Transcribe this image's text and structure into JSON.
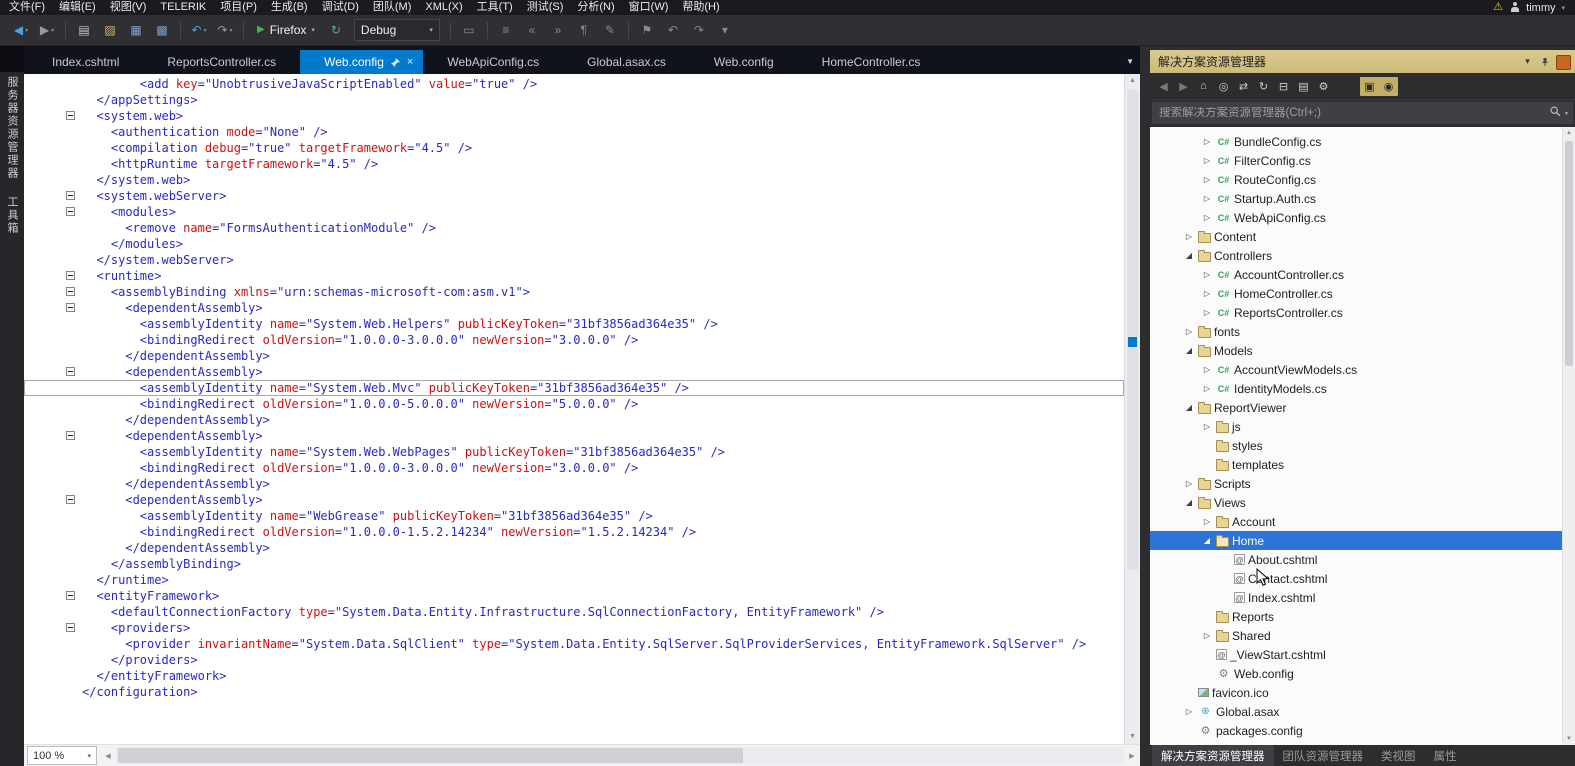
{
  "colors": {
    "accent": "#007acc",
    "selection": "#2e74d8",
    "xml_tag": "#2828c8",
    "xml_attr": "#d01010",
    "folder": "#e9d498",
    "folder_border": "#a98f4d",
    "csharp_green": "#36a163",
    "warning_yellow": "#f2c12e"
  },
  "menu": {
    "items": [
      "文件(F)",
      "编辑(E)",
      "视图(V)",
      "TELERIK",
      "项目(P)",
      "生成(B)",
      "调试(D)",
      "团队(M)",
      "XML(X)",
      "工具(T)",
      "测试(S)",
      "分析(N)",
      "窗口(W)",
      "帮助(H)"
    ],
    "warning_glyph": "⚠",
    "user": "timmy"
  },
  "toolbar": {
    "items": [
      {
        "type": "btn",
        "name": "navigate-back-button",
        "glyph": "◀",
        "color": "#4aa0e0",
        "caret": true
      },
      {
        "type": "btn",
        "name": "navigate-forward-button",
        "glyph": "▶",
        "color": "#9a9a9a",
        "caret": true
      },
      {
        "type": "sep"
      },
      {
        "type": "btn",
        "name": "new-file-button",
        "glyph": "▤",
        "color": "#c8c8c8"
      },
      {
        "type": "btn",
        "name": "open-file-button",
        "glyph": "▨",
        "color": "#d8b56a"
      },
      {
        "type": "btn",
        "name": "save-button",
        "glyph": "▦",
        "color": "#7f9fd0"
      },
      {
        "type": "btn",
        "name": "save-all-button",
        "glyph": "▩",
        "color": "#7f9fd0"
      },
      {
        "type": "sep"
      },
      {
        "type": "btn",
        "name": "undo-button",
        "glyph": "↶",
        "color": "#4aa0e0",
        "caret": true
      },
      {
        "type": "btn",
        "name": "redo-button",
        "glyph": "↷",
        "color": "#9a9a9a",
        "caret": true
      },
      {
        "type": "sep"
      },
      {
        "type": "run",
        "name": "start-debug-button",
        "label": "Firefox",
        "play_color": "#3db93d"
      },
      {
        "type": "btn",
        "name": "refresh-button",
        "glyph": "↻",
        "color": "#49b0a0"
      },
      {
        "type": "combo",
        "name": "solution-configuration-select",
        "label": "Debug"
      },
      {
        "type": "sep"
      },
      {
        "type": "btn",
        "name": "xml-schemas-button",
        "glyph": "▭",
        "color": "#8a8a8a"
      },
      {
        "type": "sep"
      },
      {
        "type": "btn",
        "name": "format-document-button",
        "glyph": "≡",
        "color": "#8a8a8a"
      },
      {
        "type": "btn",
        "name": "decrease-indent-button",
        "glyph": "«",
        "color": "#8a8a8a"
      },
      {
        "type": "btn",
        "name": "increase-indent-button",
        "glyph": "»",
        "color": "#8a8a8a"
      },
      {
        "type": "btn",
        "name": "comment-button",
        "glyph": "¶",
        "color": "#8a8a8a"
      },
      {
        "type": "btn",
        "name": "uncomment-button",
        "glyph": "✎",
        "color": "#8a8a8a"
      },
      {
        "type": "sep"
      },
      {
        "type": "btn",
        "name": "bookmark-button",
        "glyph": "⚑",
        "color": "#8a8a8a"
      },
      {
        "type": "btn",
        "name": "prev-bookmark-button",
        "glyph": "↶",
        "color": "#8a8a8a"
      },
      {
        "type": "btn",
        "name": "next-bookmark-button",
        "glyph": "↷",
        "color": "#8a8a8a"
      },
      {
        "type": "btn",
        "name": "toolbar-options-button",
        "glyph": "▾",
        "color": "#8a8a8a"
      }
    ]
  },
  "side_tabs": [
    "服务器资源管理器",
    "工具箱"
  ],
  "tabs": [
    {
      "label": "Index.cshtml",
      "active": false
    },
    {
      "label": "ReportsController.cs",
      "active": false
    },
    {
      "label": "Web.config",
      "active": true
    },
    {
      "label": "WebApiConfig.cs",
      "active": false
    },
    {
      "label": "Global.asax.cs",
      "active": false
    },
    {
      "label": "Web.config",
      "active": false
    },
    {
      "label": "HomeController.cs",
      "active": false
    }
  ],
  "editor": {
    "zoom_label": "100 %",
    "lines": [
      {
        "text": "        <add key=\"UnobtrusiveJavaScriptEnabled\" value=\"true\" />"
      },
      {
        "text": "  </appSettings>"
      },
      {
        "text": "  <system.web>",
        "fold": true
      },
      {
        "text": "    <authentication mode=\"None\" />"
      },
      {
        "text": "    <compilation debug=\"true\" targetFramework=\"4.5\" />"
      },
      {
        "text": "    <httpRuntime targetFramework=\"4.5\" />"
      },
      {
        "text": "  </system.web>"
      },
      {
        "text": "  <system.webServer>",
        "fold": true
      },
      {
        "text": "    <modules>",
        "fold": true
      },
      {
        "text": "      <remove name=\"FormsAuthenticationModule\" />"
      },
      {
        "text": "    </modules>"
      },
      {
        "text": "  </system.webServer>"
      },
      {
        "text": "  <runtime>",
        "fold": true
      },
      {
        "text": "    <assemblyBinding xmlns=\"urn:schemas-microsoft-com:asm.v1\">",
        "fold": true
      },
      {
        "text": "      <dependentAssembly>",
        "fold": true
      },
      {
        "text": "        <assemblyIdentity name=\"System.Web.Helpers\" publicKeyToken=\"31bf3856ad364e35\" />"
      },
      {
        "text": "        <bindingRedirect oldVersion=\"1.0.0.0-3.0.0.0\" newVersion=\"3.0.0.0\" />"
      },
      {
        "text": "      </dependentAssembly>"
      },
      {
        "text": "      <dependentAssembly>",
        "fold": true
      },
      {
        "text": "        <assemblyIdentity name=\"System.Web.Mvc\" publicKeyToken=\"31bf3856ad364e35\" />",
        "current": true
      },
      {
        "text": "        <bindingRedirect oldVersion=\"1.0.0.0-5.0.0.0\" newVersion=\"5.0.0.0\" />"
      },
      {
        "text": "      </dependentAssembly>"
      },
      {
        "text": "      <dependentAssembly>",
        "fold": true
      },
      {
        "text": "        <assemblyIdentity name=\"System.Web.WebPages\" publicKeyToken=\"31bf3856ad364e35\" />"
      },
      {
        "text": "        <bindingRedirect oldVersion=\"1.0.0.0-3.0.0.0\" newVersion=\"3.0.0.0\" />"
      },
      {
        "text": "      </dependentAssembly>"
      },
      {
        "text": "      <dependentAssembly>",
        "fold": true
      },
      {
        "text": "        <assemblyIdentity name=\"WebGrease\" publicKeyToken=\"31bf3856ad364e35\" />"
      },
      {
        "text": "        <bindingRedirect oldVersion=\"1.0.0.0-1.5.2.14234\" newVersion=\"1.5.2.14234\" />"
      },
      {
        "text": "      </dependentAssembly>"
      },
      {
        "text": "    </assemblyBinding>"
      },
      {
        "text": "  </runtime>"
      },
      {
        "text": "  <entityFramework>",
        "fold": true
      },
      {
        "text": "    <defaultConnectionFactory type=\"System.Data.Entity.Infrastructure.SqlConnectionFactory, EntityFramework\" />"
      },
      {
        "text": "    <providers>",
        "fold": true
      },
      {
        "text": "      <provider invariantName=\"System.Data.SqlClient\" type=\"System.Data.Entity.SqlServer.SqlProviderServices, EntityFramework.SqlServer\" />"
      },
      {
        "text": "    </providers>"
      },
      {
        "text": "  </entityFramework>"
      },
      {
        "text": "</configuration>"
      }
    ]
  },
  "solution_explorer": {
    "title": "解决方案资源管理器",
    "search_placeholder": "搜索解决方案资源管理器(Ctrl+;)",
    "toolbar": [
      {
        "name": "back-icon",
        "glyph": "◀",
        "dim": true
      },
      {
        "name": "forward-icon",
        "glyph": "▶",
        "dim": true
      },
      {
        "name": "home-icon",
        "glyph": "⌂"
      },
      {
        "name": "switch-views-icon",
        "glyph": "◎"
      },
      {
        "name": "sync-with-active-document-icon",
        "glyph": "⇄"
      },
      {
        "name": "refresh-icon",
        "glyph": "↻"
      },
      {
        "name": "collapse-all-icon",
        "glyph": "⊟"
      },
      {
        "name": "show-all-files-icon",
        "glyph": "▤"
      },
      {
        "name": "properties-icon",
        "glyph": "⚙"
      },
      {
        "name": "preview-selected-items-icon",
        "glyph": "▣",
        "highlight": true
      },
      {
        "name": "pending-changes-filter-icon",
        "glyph": "◉",
        "highlight": true
      }
    ],
    "tree": [
      {
        "label": "BundleConfig.cs",
        "level": 3,
        "icon": "csharp",
        "expander": "collapsed"
      },
      {
        "label": "FilterConfig.cs",
        "level": 3,
        "icon": "csharp",
        "expander": "collapsed"
      },
      {
        "label": "RouteConfig.cs",
        "level": 3,
        "icon": "csharp",
        "expander": "collapsed"
      },
      {
        "label": "Startup.Auth.cs",
        "level": 3,
        "icon": "csharp",
        "expander": "collapsed"
      },
      {
        "label": "WebApiConfig.cs",
        "level": 3,
        "icon": "csharp",
        "expander": "collapsed"
      },
      {
        "label": "Content",
        "level": 2,
        "icon": "folder",
        "expander": "collapsed"
      },
      {
        "label": "Controllers",
        "level": 2,
        "icon": "folder",
        "expander": "expanded"
      },
      {
        "label": "AccountController.cs",
        "level": 3,
        "icon": "csharp",
        "expander": "collapsed"
      },
      {
        "label": "HomeController.cs",
        "level": 3,
        "icon": "csharp",
        "expander": "collapsed"
      },
      {
        "label": "ReportsController.cs",
        "level": 3,
        "icon": "csharp",
        "expander": "collapsed"
      },
      {
        "label": "fonts",
        "level": 2,
        "icon": "folder",
        "expander": "collapsed"
      },
      {
        "label": "Models",
        "level": 2,
        "icon": "folder",
        "expander": "expanded"
      },
      {
        "label": "AccountViewModels.cs",
        "level": 3,
        "icon": "csharp",
        "expander": "collapsed"
      },
      {
        "label": "IdentityModels.cs",
        "level": 3,
        "icon": "csharp",
        "expander": "collapsed"
      },
      {
        "label": "ReportViewer",
        "level": 2,
        "icon": "folder",
        "expander": "expanded"
      },
      {
        "label": "js",
        "level": 3,
        "icon": "folder",
        "expander": "collapsed"
      },
      {
        "label": "styles",
        "level": 3,
        "icon": "folder",
        "expander": "none"
      },
      {
        "label": "templates",
        "level": 3,
        "icon": "folder",
        "expander": "none"
      },
      {
        "label": "Scripts",
        "level": 2,
        "icon": "folder",
        "expander": "collapsed"
      },
      {
        "label": "Views",
        "level": 2,
        "icon": "folder",
        "expander": "expanded"
      },
      {
        "label": "Account",
        "level": 3,
        "icon": "folder",
        "expander": "collapsed"
      },
      {
        "label": "Home",
        "level": 3,
        "icon": "folder-open",
        "expander": "expanded",
        "selected": true
      },
      {
        "label": "About.cshtml",
        "level": 4,
        "icon": "cshtml",
        "expander": "none"
      },
      {
        "label": "Contact.cshtml",
        "level": 4,
        "icon": "cshtml",
        "expander": "none"
      },
      {
        "label": "Index.cshtml",
        "level": 4,
        "icon": "cshtml",
        "expander": "none"
      },
      {
        "label": "Reports",
        "level": 3,
        "icon": "folder",
        "expander": "none"
      },
      {
        "label": "Shared",
        "level": 3,
        "icon": "folder",
        "expander": "collapsed"
      },
      {
        "label": "_ViewStart.cshtml",
        "level": 3,
        "icon": "cshtml",
        "expander": "none"
      },
      {
        "label": "Web.config",
        "level": 3,
        "icon": "config",
        "expander": "none"
      },
      {
        "label": "favicon.ico",
        "level": 2,
        "icon": "image",
        "expander": "none"
      },
      {
        "label": "Global.asax",
        "level": 2,
        "icon": "asax",
        "expander": "collapsed"
      },
      {
        "label": "packages.config",
        "level": 2,
        "icon": "config",
        "expander": "none"
      }
    ],
    "bottom_tabs": [
      {
        "label": "解决方案资源管理器",
        "active": true
      },
      {
        "label": "团队资源管理器",
        "active": false
      },
      {
        "label": "类视图",
        "active": false
      },
      {
        "label": "属性",
        "active": false
      }
    ]
  }
}
